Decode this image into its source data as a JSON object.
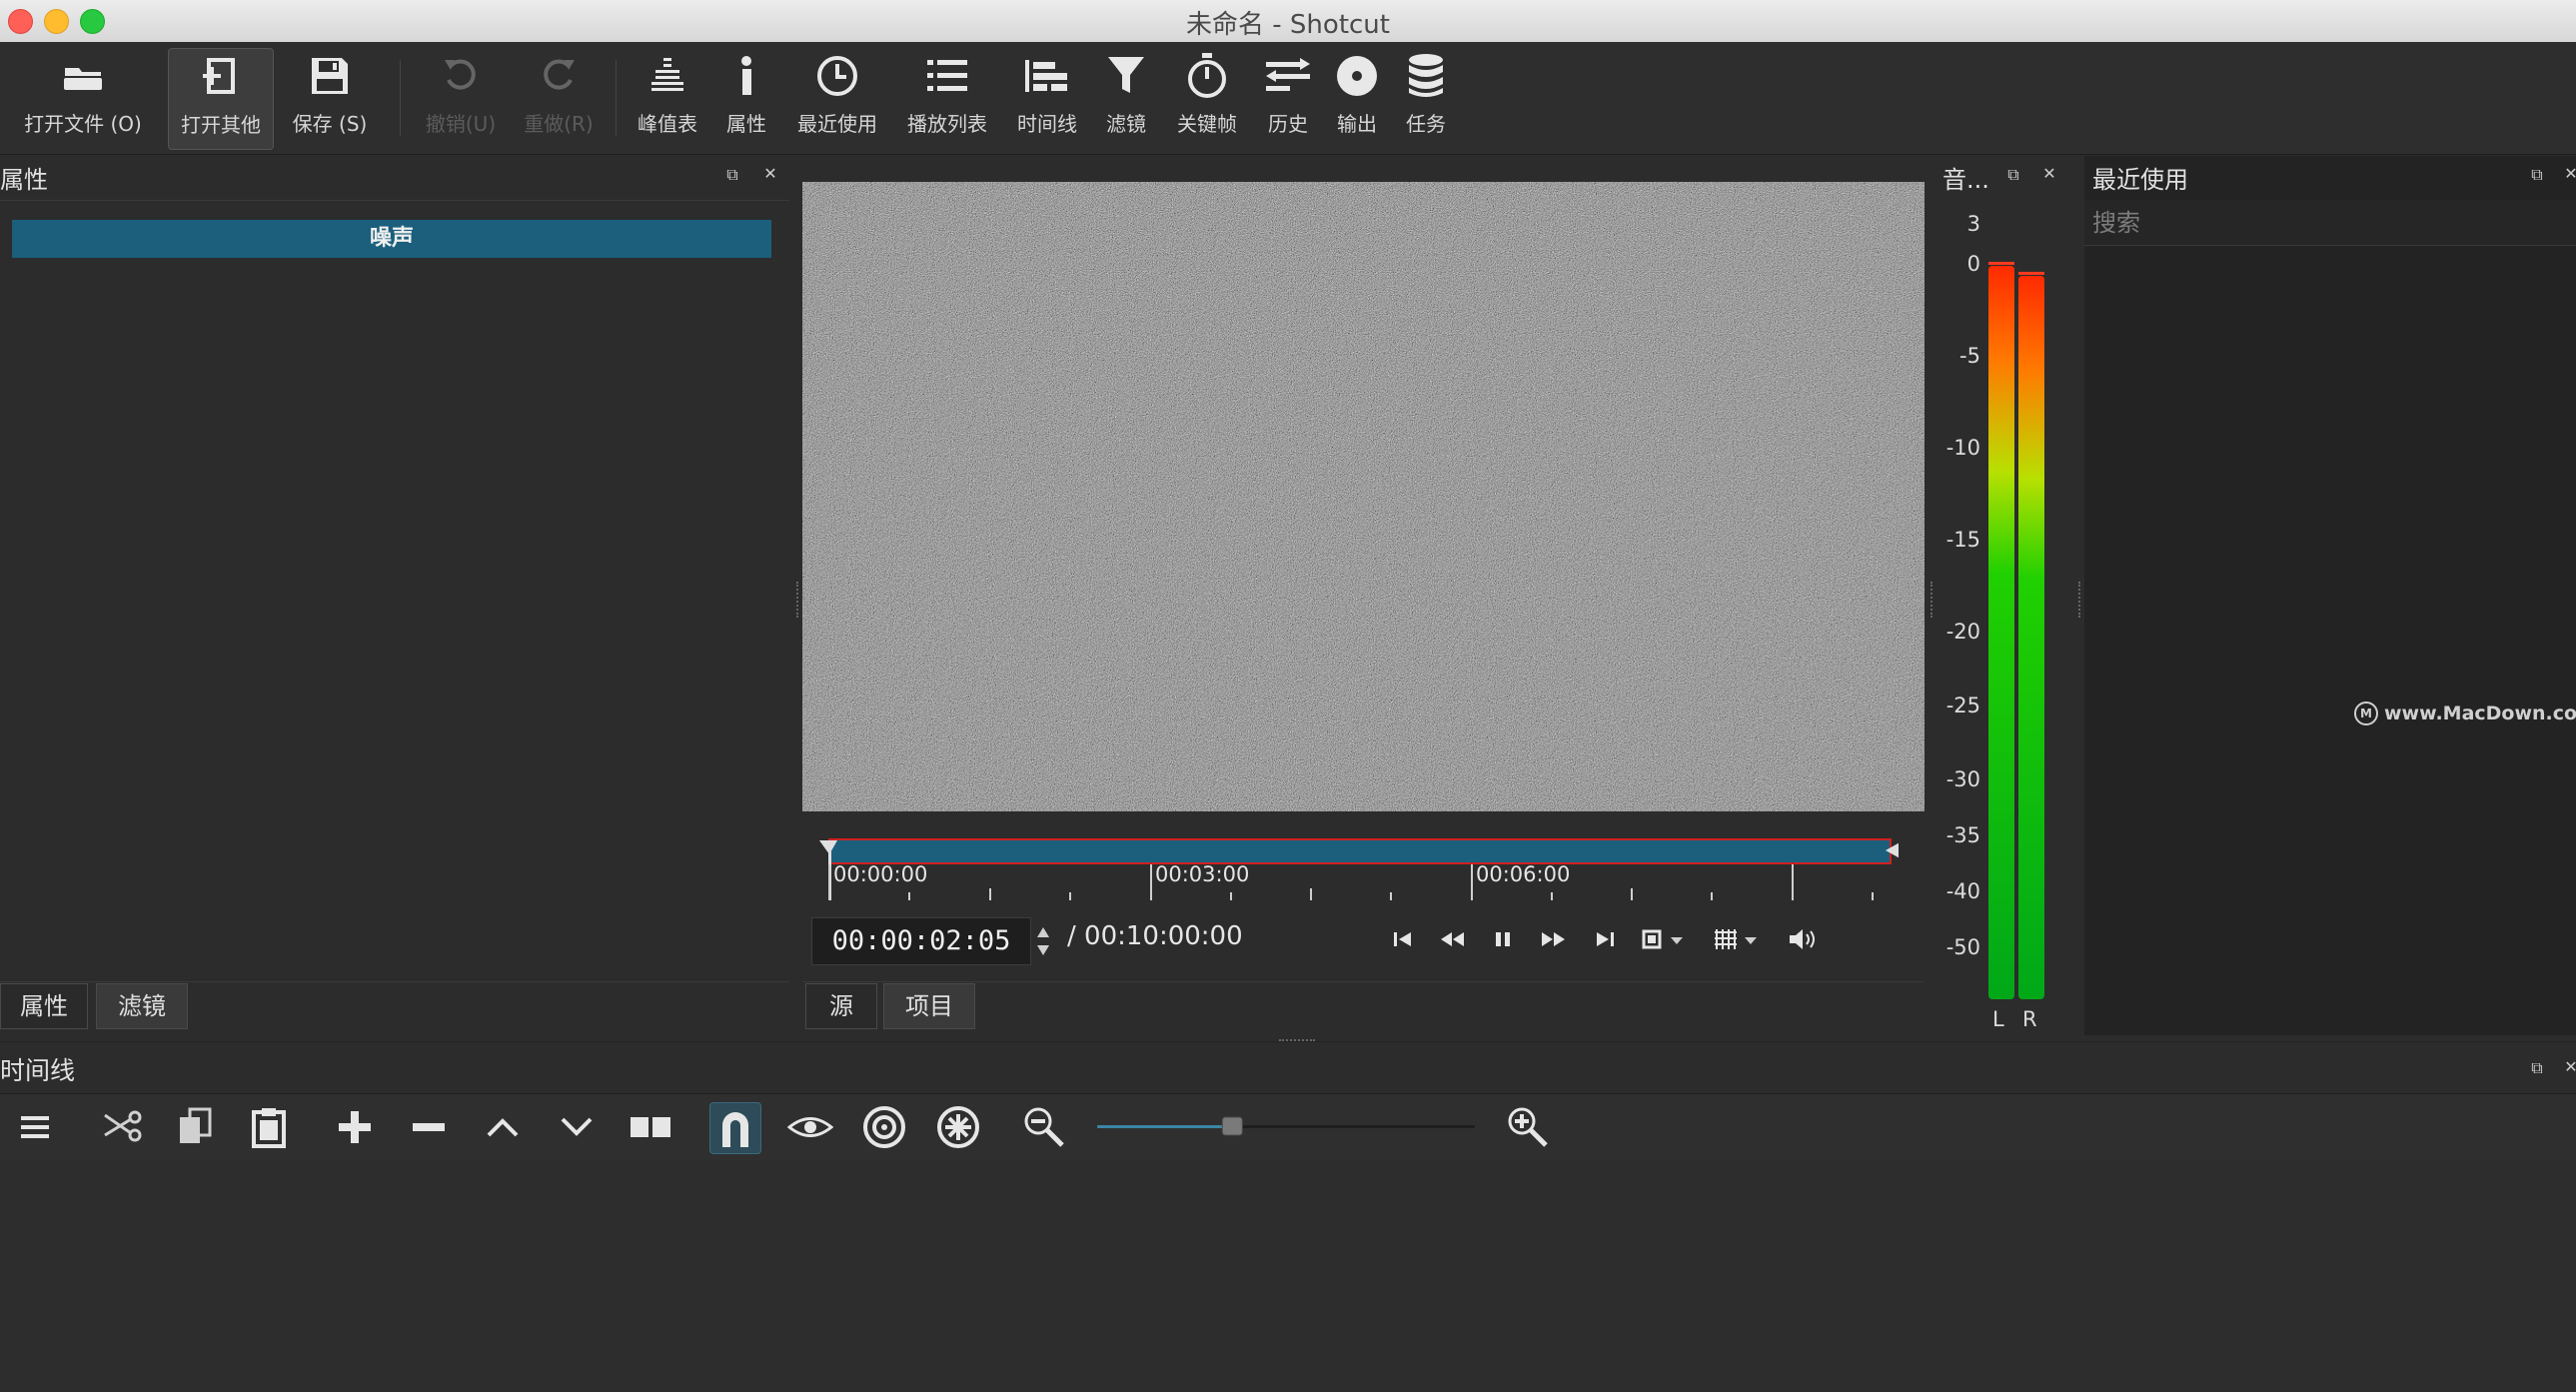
{
  "window": {
    "title": "未命名 - Shotcut"
  },
  "colors": {
    "accent": "#1b5f7d",
    "meter_high": "#ff2a00",
    "meter_low": "#00c41e",
    "close": "#fe5f57",
    "minimize": "#febc2e",
    "zoom": "#28c840"
  },
  "toolbar": {
    "items": [
      {
        "label": "打开文件 (O)",
        "icon": "open-folder-icon"
      },
      {
        "label": "打开其他",
        "icon": "open-other-icon"
      },
      {
        "label": "保存 (S)",
        "icon": "save-icon"
      },
      {
        "label": "撤销(U)",
        "icon": "undo-icon"
      },
      {
        "label": "重做(R)",
        "icon": "redo-icon"
      },
      {
        "label": "峰值表",
        "icon": "peak-meter-icon"
      },
      {
        "label": "属性",
        "icon": "info-icon"
      },
      {
        "label": "最近使用",
        "icon": "clock-icon"
      },
      {
        "label": "播放列表",
        "icon": "playlist-icon"
      },
      {
        "label": "时间线",
        "icon": "timeline-icon"
      },
      {
        "label": "滤镜",
        "icon": "filter-icon"
      },
      {
        "label": "关键帧",
        "icon": "stopwatch-icon"
      },
      {
        "label": "历史",
        "icon": "history-icon"
      },
      {
        "label": "输出",
        "icon": "export-icon"
      },
      {
        "label": "任务",
        "icon": "jobs-icon"
      }
    ]
  },
  "properties": {
    "title": "属性",
    "clip_name": "噪声",
    "tabs": [
      "属性",
      "滤镜"
    ]
  },
  "player": {
    "ruler_labels": [
      "00:00:00",
      "00:03:00",
      "00:06:00"
    ],
    "position": "00:00:02:05",
    "duration": "/ 00:10:00:00",
    "tabs": [
      "源",
      "项目"
    ]
  },
  "meter": {
    "title": "音...",
    "scale": [
      "3",
      "0",
      "-5",
      "-10",
      "-15",
      "-20",
      "-25",
      "-30",
      "-35",
      "-40",
      "-50"
    ],
    "channels": [
      "L",
      "R"
    ]
  },
  "recent": {
    "title": "最近使用",
    "search_placeholder": "搜索",
    "watermark": "www.MacDown.com"
  },
  "timeline": {
    "title": "时间线",
    "zoom_fraction": 0.35
  }
}
